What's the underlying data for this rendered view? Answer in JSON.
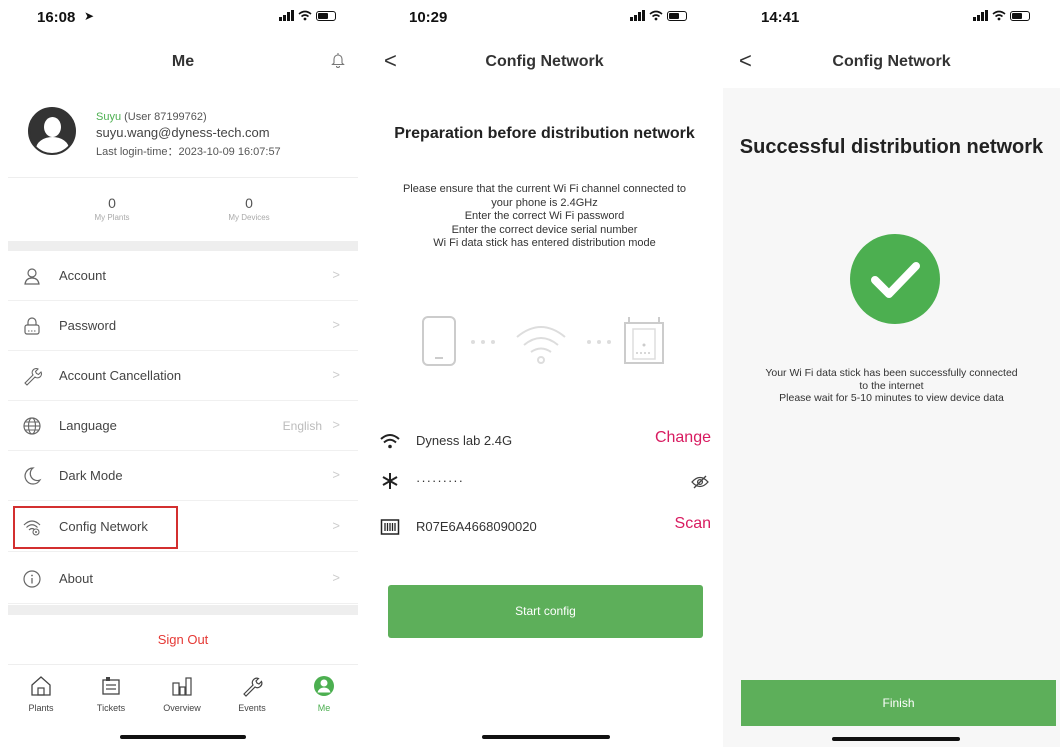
{
  "colors": {
    "accent_green": "#5daf5a",
    "danger_red": "#d32f2f",
    "link_pink": "#d81b60"
  },
  "screen1": {
    "time": "16:08",
    "title": "Me",
    "user": {
      "name": "Suyu",
      "id_label": "(User 87199762)",
      "email": "suyu.wang@dyness-tech.com",
      "last_login": "Last login-time：2023-10-09 16:07:57"
    },
    "stats": [
      {
        "value": "0",
        "label": "My Plants"
      },
      {
        "value": "0",
        "label": "My Devices"
      }
    ],
    "menu": [
      {
        "label": "Account",
        "value": "",
        "icon": "user-icon"
      },
      {
        "label": "Password",
        "value": "",
        "icon": "lock-icon"
      },
      {
        "label": "Account Cancellation",
        "value": "",
        "icon": "wrench-icon"
      },
      {
        "label": "Language",
        "value": "English",
        "icon": "globe-icon"
      },
      {
        "label": "Dark Mode",
        "value": "",
        "icon": "moon-icon"
      },
      {
        "label": "Config Network",
        "value": "",
        "icon": "wifi-config-icon"
      },
      {
        "label": "About",
        "value": "",
        "icon": "info-icon"
      }
    ],
    "chevron": ">",
    "sign_out": "Sign Out",
    "tabs": [
      {
        "label": "Plants",
        "icon": "home-icon"
      },
      {
        "label": "Tickets",
        "icon": "ticket-icon"
      },
      {
        "label": "Overview",
        "icon": "chart-icon"
      },
      {
        "label": "Events",
        "icon": "wrench-icon"
      },
      {
        "label": "Me",
        "icon": "profile-icon"
      }
    ]
  },
  "screen2": {
    "time": "10:29",
    "back": "<",
    "title": "Config Network",
    "prep_title": "Preparation before distribution network",
    "prep_lines": [
      "Please ensure that the current Wi Fi channel connected to your phone is 2.4GHz",
      "Enter the correct Wi Fi password",
      "Enter the correct device serial number",
      "Wi Fi data stick has entered distribution mode"
    ],
    "wifi_name": "Dyness lab 2.4G",
    "change": "Change",
    "password_mask": "·········",
    "serial": "R07E6A4668090020",
    "scan": "Scan",
    "start_button": "Start config"
  },
  "screen3": {
    "time": "14:41",
    "back": "<",
    "title": "Config Network",
    "success_title": "Successful distribution network",
    "success_lines": [
      "Your Wi Fi data stick has been successfully connected to the internet",
      "Please wait for 5-10 minutes to view device data"
    ],
    "finish_button": "Finish"
  }
}
